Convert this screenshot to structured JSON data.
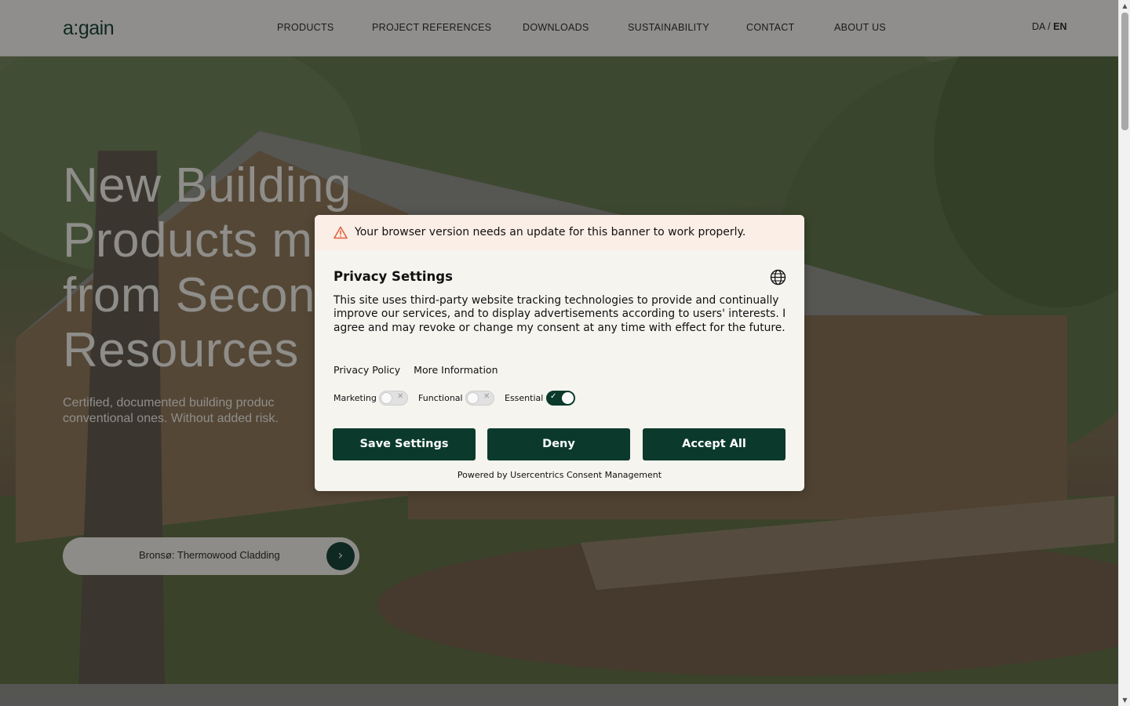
{
  "header": {
    "logo": "a:gain",
    "nav": [
      {
        "label": "PRODUCTS",
        "name": "nav-products"
      },
      {
        "label": "PROJECT REFERENCES",
        "name": "nav-project-references"
      },
      {
        "label": "DOWNLOADS",
        "name": "nav-downloads"
      },
      {
        "label": "SUSTAINABILITY",
        "name": "nav-sustainability"
      },
      {
        "label": "CONTACT",
        "name": "nav-contact"
      },
      {
        "label": "ABOUT US",
        "name": "nav-about-us"
      }
    ],
    "lang": {
      "da": "DA",
      "separator": "/",
      "en": "EN",
      "active": "EN"
    }
  },
  "hero": {
    "title_lines": [
      "New Building",
      "Products m",
      "from Secon",
      "Resources"
    ],
    "subtitle_lines": [
      "Certified, documented building produc",
      "conventional ones. Without added risk."
    ],
    "feature_label": "Bronsø: Thermowood Cladding",
    "feature_icon": "chevron-right-icon"
  },
  "consent": {
    "warning_icon": "warning-triangle-icon",
    "warning_text": "Your browser version needs an update for this banner to work properly.",
    "title": "Privacy Settings",
    "language_icon": "globe-icon",
    "body": "This site uses third-party website tracking technologies to provide and continually improve our services, and to display advertisements according to users' interests. I agree and may revoke or change my consent at any time with effect for the future.",
    "links": {
      "privacy_policy": "Privacy Policy",
      "more_information": "More Information"
    },
    "toggles": {
      "marketing": {
        "label": "Marketing",
        "on": false
      },
      "functional": {
        "label": "Functional",
        "on": false
      },
      "essential": {
        "label": "Essential",
        "on": true
      }
    },
    "buttons": {
      "save": "Save Settings",
      "deny": "Deny",
      "accept": "Accept All"
    },
    "powered_by": "Powered by Usercentrics Consent Management"
  },
  "colors": {
    "brand_dark_green": "#0b3a2c",
    "header_bg": "#f4f3ef",
    "dialog_bg": "#f5f4ef",
    "warning_bg": "#fbeee6",
    "warning_icon": "#e0613f"
  }
}
